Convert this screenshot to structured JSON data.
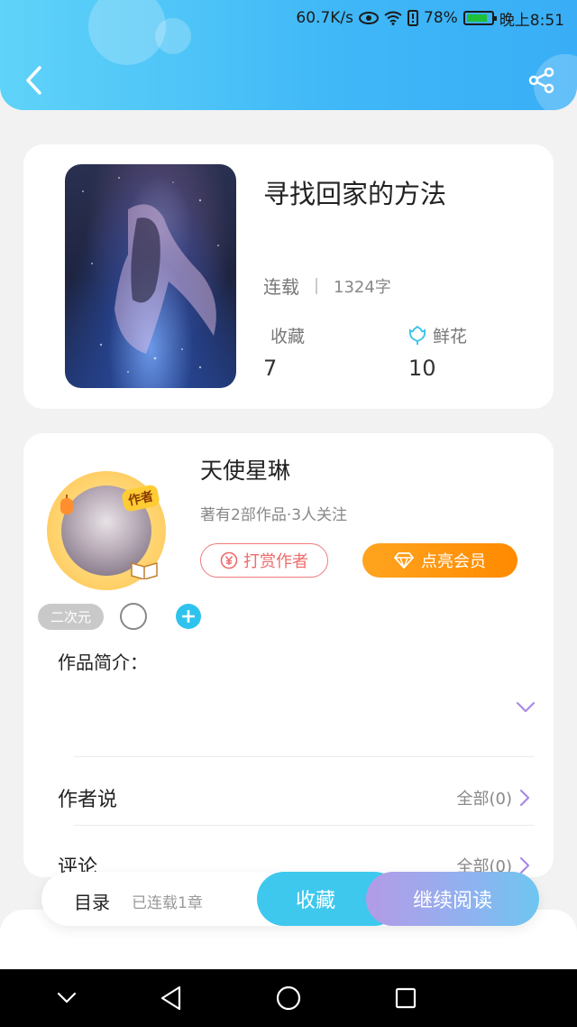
{
  "status_bar": {
    "speed": "60.7K/s",
    "battery": "78%",
    "time": "晚上8:51"
  },
  "header": {
    "back_icon": "chevron-left-icon",
    "share_icon": "share-icon"
  },
  "book": {
    "title": "寻找回家的方法",
    "status": "连载",
    "word_count": "1324字",
    "favorites_label": "收藏",
    "favorites_value": "7",
    "flowers_label": "鲜花",
    "flowers_value": "10"
  },
  "author": {
    "badge": "作者",
    "name": "天使星琳",
    "subtitle": "著有2部作品·3人关注",
    "reward_button": "打赏作者",
    "vip_button": "点亮会员",
    "tag": "二次元",
    "intro_label": "作品简介：",
    "author_says_label": "作者说",
    "author_says_link": "全部(0)",
    "comments_label": "评论",
    "comments_link": "全部(0)"
  },
  "action_bar": {
    "toc_label": "目录",
    "toc_sub": "已连载1章",
    "collect_button": "收藏",
    "read_button": "继续阅读"
  },
  "colors": {
    "header_blue": "#3fb7f7",
    "accent_cyan": "#3fc8ee",
    "reward_red": "#ee6b6b",
    "vip_orange": "#ff8a00",
    "purple_chevron": "#a98ae8"
  }
}
